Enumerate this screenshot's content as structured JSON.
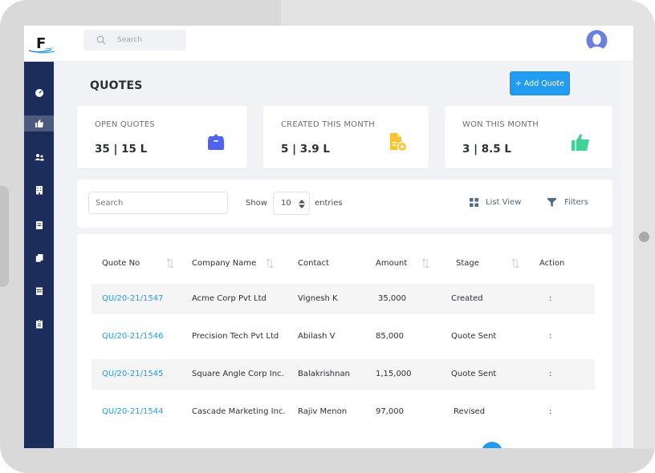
{
  "header": {
    "logo_letter": "F",
    "search_placeholder": "Search"
  },
  "sidebar": {
    "items": [
      {
        "name": "dashboard",
        "icon": "speedometer-icon",
        "active": false
      },
      {
        "name": "quotes",
        "icon": "thumbs-up-icon",
        "active": true
      },
      {
        "name": "contacts",
        "icon": "users-icon",
        "active": false
      },
      {
        "name": "companies",
        "icon": "building-icon",
        "active": false
      },
      {
        "name": "documents",
        "icon": "document-icon",
        "active": false
      },
      {
        "name": "copies",
        "icon": "copy-icon",
        "active": false
      },
      {
        "name": "calendar",
        "icon": "calendar-icon",
        "active": false
      },
      {
        "name": "clipboard",
        "icon": "clipboard-icon",
        "active": false
      }
    ]
  },
  "page": {
    "title": "QUOTES",
    "add_button": "+ Add Quote"
  },
  "stats": [
    {
      "label": "OPEN QUOTES",
      "value": "35 | 15 L",
      "icon": "box-icon",
      "color": "#4f63f0"
    },
    {
      "label": "CREATED THIS MONTH",
      "value": "5 | 3.9 L",
      "icon": "file-add-icon",
      "color": "#f7c32e"
    },
    {
      "label": "WON THIS MONTH",
      "value": "3 | 8.5 L",
      "icon": "thumbs-up-icon",
      "color": "#3fd196"
    }
  ],
  "filters": {
    "search_placeholder": "Search",
    "show_label": "Show",
    "entries_value": "10",
    "entries_label": "entries",
    "list_view_label": "List View",
    "filters_label": "Filters"
  },
  "table": {
    "columns": [
      "Quote No",
      "Company Name",
      "Contact",
      "Amount",
      "Stage",
      "Action"
    ],
    "rows": [
      {
        "quote_no": "QU/20-21/1547",
        "company": "Acme Corp Pvt Ltd",
        "contact": "Vignesh K",
        "amount": "35,000",
        "stage": "Created",
        "action": ":"
      },
      {
        "quote_no": "QU/20-21/1546",
        "company": "Precision Tech Pvt Ltd",
        "contact": "Abilash V",
        "amount": "85,000",
        "stage": "Quote Sent",
        "action": ":"
      },
      {
        "quote_no": "QU/20-21/1545",
        "company": "Square Angle Corp Inc.",
        "contact": "Balakrishnan",
        "amount": "1,15,000",
        "stage": "Quote Sent",
        "action": ":"
      },
      {
        "quote_no": "QU/20-21/1544",
        "company": "Cascade Marketing Inc.",
        "contact": "Rajiv Menon",
        "amount": "97,000",
        "stage": "Revised",
        "action": ":"
      }
    ]
  },
  "colors": {
    "accent": "#229cf1",
    "sidebar": "#1c2c5b"
  }
}
